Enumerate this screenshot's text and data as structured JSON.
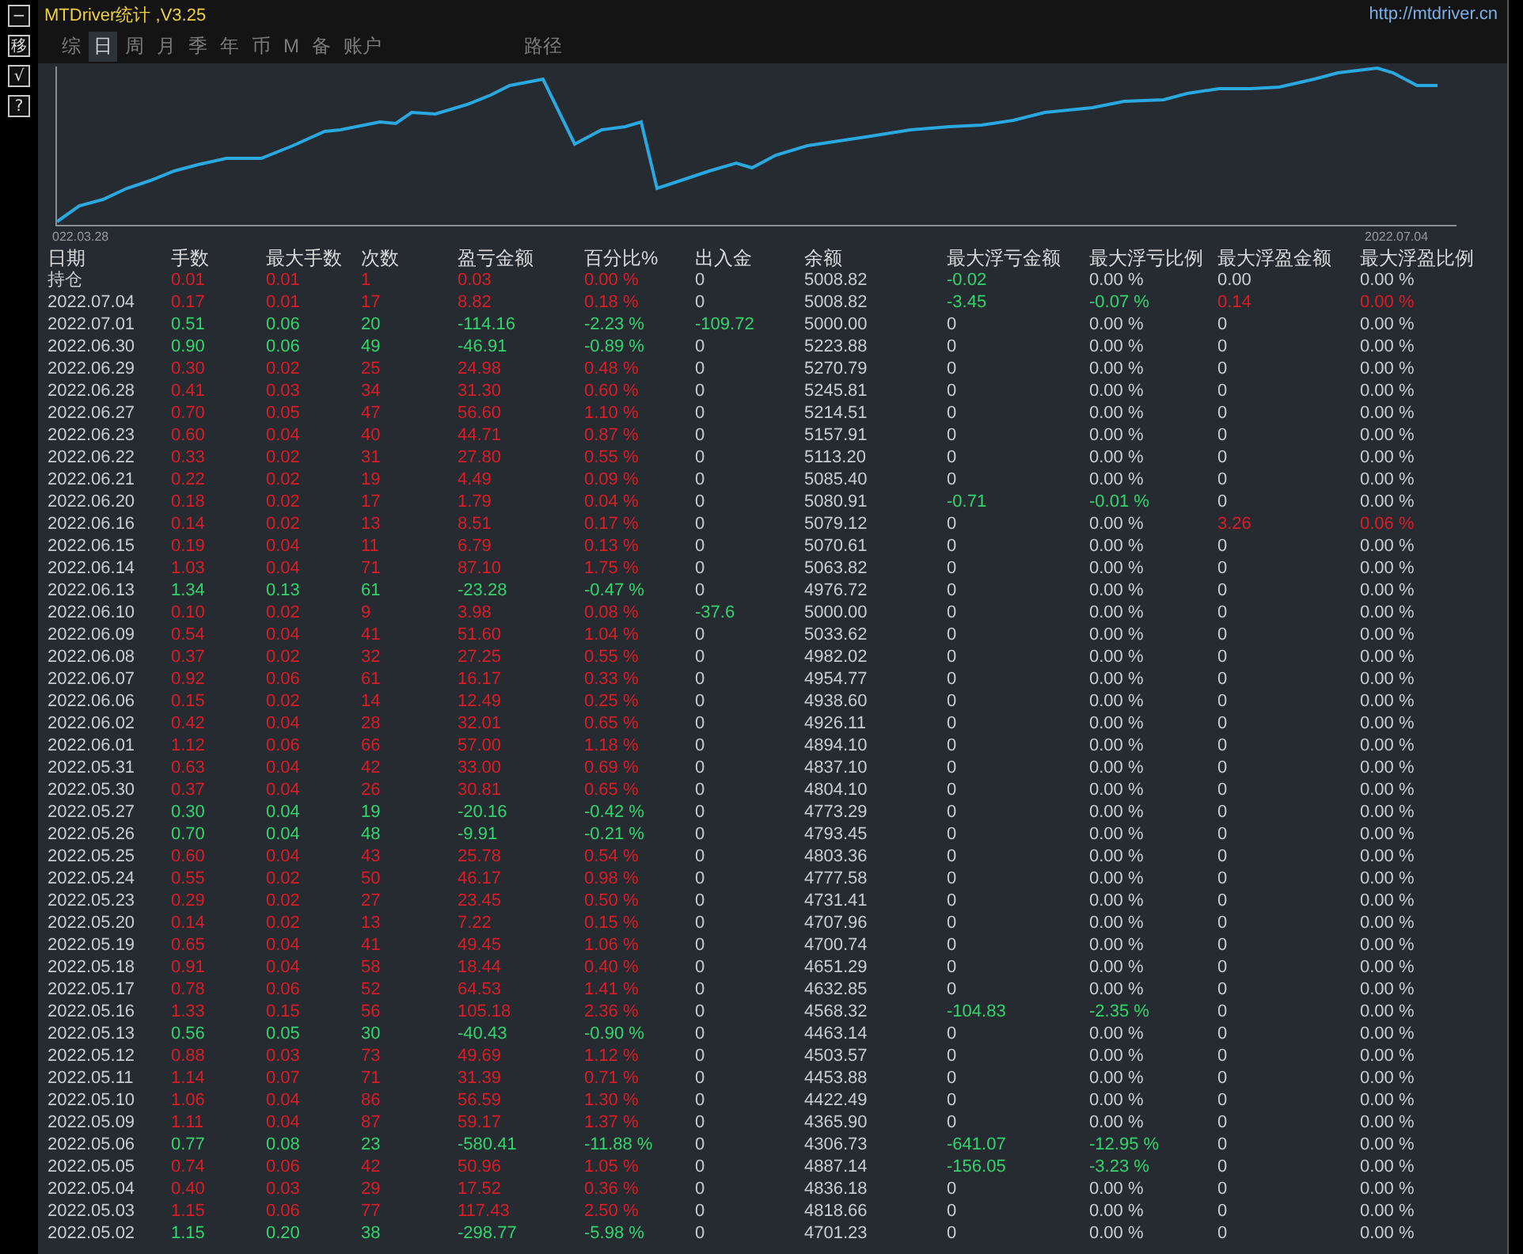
{
  "side_buttons": [
    "−",
    "移",
    "√",
    "?"
  ],
  "window": {
    "title": "MTDriver统计 ,V3.25",
    "link": "http://mtdriver.cn"
  },
  "tabs": [
    {
      "label": "综",
      "selected": false
    },
    {
      "label": "日",
      "selected": true
    },
    {
      "label": "周",
      "selected": false
    },
    {
      "label": "月",
      "selected": false
    },
    {
      "label": "季",
      "selected": false
    },
    {
      "label": "年",
      "selected": false
    },
    {
      "label": "币",
      "selected": false
    },
    {
      "label": "M",
      "selected": false
    },
    {
      "label": "备",
      "selected": false
    },
    {
      "label": "账户",
      "selected": false
    }
  ],
  "path_label": "路径",
  "equity_chart": {
    "start_label": "022.03.28",
    "end_label": "2022.07.04"
  },
  "table": {
    "columns": [
      "日期",
      "手数",
      "最大手数",
      "次数",
      "盈亏金额",
      "百分比%",
      "出入金",
      "余额",
      "最大浮亏金额",
      "最大浮亏比例",
      "最大浮盈金额",
      "最大浮盈比例"
    ],
    "rows": [
      {
        "cells": [
          "持仓",
          "0.01",
          "0.01",
          "1",
          "0.03",
          "0.00 %",
          "0",
          "5008.82",
          "-0.02",
          "0.00 %",
          "0.00",
          "0.00 %"
        ],
        "kind": "gain",
        "flow_highlighted": false,
        "float_loss_highlighted": true,
        "float_loss_pct_highlighted": false,
        "float_gain_highlighted": false
      },
      {
        "cells": [
          "2022.07.04",
          "0.17",
          "0.01",
          "17",
          "8.82",
          "0.18 %",
          "0",
          "5008.82",
          "-3.45",
          "-0.07 %",
          "0.14",
          "0.00 %"
        ],
        "kind": "gain",
        "flow_highlighted": false,
        "float_loss_highlighted": true,
        "float_loss_pct_highlighted": true,
        "float_gain_highlighted": true
      },
      {
        "cells": [
          "2022.07.01",
          "0.51",
          "0.06",
          "20",
          "-114.16",
          "-2.23 %",
          "-109.72",
          "5000.00",
          "0",
          "0.00 %",
          "0",
          "0.00 %"
        ],
        "kind": "loss",
        "flow_highlighted": true,
        "float_loss_highlighted": false,
        "float_loss_pct_highlighted": false,
        "float_gain_highlighted": false
      },
      {
        "cells": [
          "2022.06.30",
          "0.90",
          "0.06",
          "49",
          "-46.91",
          "-0.89 %",
          "0",
          "5223.88",
          "0",
          "0.00 %",
          "0",
          "0.00 %"
        ],
        "kind": "loss",
        "flow_highlighted": false,
        "float_loss_highlighted": false,
        "float_loss_pct_highlighted": false,
        "float_gain_highlighted": false
      },
      {
        "cells": [
          "2022.06.29",
          "0.30",
          "0.02",
          "25",
          "24.98",
          "0.48 %",
          "0",
          "5270.79",
          "0",
          "0.00 %",
          "0",
          "0.00 %"
        ],
        "kind": "gain",
        "flow_highlighted": false,
        "float_loss_highlighted": false,
        "float_loss_pct_highlighted": false,
        "float_gain_highlighted": false
      },
      {
        "cells": [
          "2022.06.28",
          "0.41",
          "0.03",
          "34",
          "31.30",
          "0.60 %",
          "0",
          "5245.81",
          "0",
          "0.00 %",
          "0",
          "0.00 %"
        ],
        "kind": "gain",
        "flow_highlighted": false,
        "float_loss_highlighted": false,
        "float_loss_pct_highlighted": false,
        "float_gain_highlighted": false
      },
      {
        "cells": [
          "2022.06.27",
          "0.70",
          "0.05",
          "47",
          "56.60",
          "1.10 %",
          "0",
          "5214.51",
          "0",
          "0.00 %",
          "0",
          "0.00 %"
        ],
        "kind": "gain",
        "flow_highlighted": false,
        "float_loss_highlighted": false,
        "float_loss_pct_highlighted": false,
        "float_gain_highlighted": false
      },
      {
        "cells": [
          "2022.06.23",
          "0.60",
          "0.04",
          "40",
          "44.71",
          "0.87 %",
          "0",
          "5157.91",
          "0",
          "0.00 %",
          "0",
          "0.00 %"
        ],
        "kind": "gain",
        "flow_highlighted": false,
        "float_loss_highlighted": false,
        "float_loss_pct_highlighted": false,
        "float_gain_highlighted": false
      },
      {
        "cells": [
          "2022.06.22",
          "0.33",
          "0.02",
          "31",
          "27.80",
          "0.55 %",
          "0",
          "5113.20",
          "0",
          "0.00 %",
          "0",
          "0.00 %"
        ],
        "kind": "gain",
        "flow_highlighted": false,
        "float_loss_highlighted": false,
        "float_loss_pct_highlighted": false,
        "float_gain_highlighted": false
      },
      {
        "cells": [
          "2022.06.21",
          "0.22",
          "0.02",
          "19",
          "4.49",
          "0.09 %",
          "0",
          "5085.40",
          "0",
          "0.00 %",
          "0",
          "0.00 %"
        ],
        "kind": "gain",
        "flow_highlighted": false,
        "float_loss_highlighted": false,
        "float_loss_pct_highlighted": false,
        "float_gain_highlighted": false
      },
      {
        "cells": [
          "2022.06.20",
          "0.18",
          "0.02",
          "17",
          "1.79",
          "0.04 %",
          "0",
          "5080.91",
          "-0.71",
          "-0.01 %",
          "0",
          "0.00 %"
        ],
        "kind": "gain",
        "flow_highlighted": false,
        "float_loss_highlighted": true,
        "float_loss_pct_highlighted": true,
        "float_gain_highlighted": false
      },
      {
        "cells": [
          "2022.06.16",
          "0.14",
          "0.02",
          "13",
          "8.51",
          "0.17 %",
          "0",
          "5079.12",
          "0",
          "0.00 %",
          "3.26",
          "0.06 %"
        ],
        "kind": "gain",
        "flow_highlighted": false,
        "float_loss_highlighted": false,
        "float_loss_pct_highlighted": false,
        "float_gain_highlighted": true
      },
      {
        "cells": [
          "2022.06.15",
          "0.19",
          "0.04",
          "11",
          "6.79",
          "0.13 %",
          "0",
          "5070.61",
          "0",
          "0.00 %",
          "0",
          "0.00 %"
        ],
        "kind": "gain",
        "flow_highlighted": false,
        "float_loss_highlighted": false,
        "float_loss_pct_highlighted": false,
        "float_gain_highlighted": false
      },
      {
        "cells": [
          "2022.06.14",
          "1.03",
          "0.04",
          "71",
          "87.10",
          "1.75 %",
          "0",
          "5063.82",
          "0",
          "0.00 %",
          "0",
          "0.00 %"
        ],
        "kind": "gain",
        "flow_highlighted": false,
        "float_loss_highlighted": false,
        "float_loss_pct_highlighted": false,
        "float_gain_highlighted": false
      },
      {
        "cells": [
          "2022.06.13",
          "1.34",
          "0.13",
          "61",
          "-23.28",
          "-0.47 %",
          "0",
          "4976.72",
          "0",
          "0.00 %",
          "0",
          "0.00 %"
        ],
        "kind": "loss",
        "flow_highlighted": false,
        "float_loss_highlighted": false,
        "float_loss_pct_highlighted": false,
        "float_gain_highlighted": false
      },
      {
        "cells": [
          "2022.06.10",
          "0.10",
          "0.02",
          "9",
          "3.98",
          "0.08 %",
          "-37.6",
          "5000.00",
          "0",
          "0.00 %",
          "0",
          "0.00 %"
        ],
        "kind": "gain",
        "flow_highlighted": true,
        "float_loss_highlighted": false,
        "float_loss_pct_highlighted": false,
        "float_gain_highlighted": false
      },
      {
        "cells": [
          "2022.06.09",
          "0.54",
          "0.04",
          "41",
          "51.60",
          "1.04 %",
          "0",
          "5033.62",
          "0",
          "0.00 %",
          "0",
          "0.00 %"
        ],
        "kind": "gain",
        "flow_highlighted": false,
        "float_loss_highlighted": false,
        "float_loss_pct_highlighted": false,
        "float_gain_highlighted": false
      },
      {
        "cells": [
          "2022.06.08",
          "0.37",
          "0.02",
          "32",
          "27.25",
          "0.55 %",
          "0",
          "4982.02",
          "0",
          "0.00 %",
          "0",
          "0.00 %"
        ],
        "kind": "gain",
        "flow_highlighted": false,
        "float_loss_highlighted": false,
        "float_loss_pct_highlighted": false,
        "float_gain_highlighted": false
      },
      {
        "cells": [
          "2022.06.07",
          "0.92",
          "0.06",
          "61",
          "16.17",
          "0.33 %",
          "0",
          "4954.77",
          "0",
          "0.00 %",
          "0",
          "0.00 %"
        ],
        "kind": "gain",
        "flow_highlighted": false,
        "float_loss_highlighted": false,
        "float_loss_pct_highlighted": false,
        "float_gain_highlighted": false
      },
      {
        "cells": [
          "2022.06.06",
          "0.15",
          "0.02",
          "14",
          "12.49",
          "0.25 %",
          "0",
          "4938.60",
          "0",
          "0.00 %",
          "0",
          "0.00 %"
        ],
        "kind": "gain",
        "flow_highlighted": false,
        "float_loss_highlighted": false,
        "float_loss_pct_highlighted": false,
        "float_gain_highlighted": false
      },
      {
        "cells": [
          "2022.06.02",
          "0.42",
          "0.04",
          "28",
          "32.01",
          "0.65 %",
          "0",
          "4926.11",
          "0",
          "0.00 %",
          "0",
          "0.00 %"
        ],
        "kind": "gain",
        "flow_highlighted": false,
        "float_loss_highlighted": false,
        "float_loss_pct_highlighted": false,
        "float_gain_highlighted": false
      },
      {
        "cells": [
          "2022.06.01",
          "1.12",
          "0.06",
          "66",
          "57.00",
          "1.18 %",
          "0",
          "4894.10",
          "0",
          "0.00 %",
          "0",
          "0.00 %"
        ],
        "kind": "gain",
        "flow_highlighted": false,
        "float_loss_highlighted": false,
        "float_loss_pct_highlighted": false,
        "float_gain_highlighted": false
      },
      {
        "cells": [
          "2022.05.31",
          "0.63",
          "0.04",
          "42",
          "33.00",
          "0.69 %",
          "0",
          "4837.10",
          "0",
          "0.00 %",
          "0",
          "0.00 %"
        ],
        "kind": "gain",
        "flow_highlighted": false,
        "float_loss_highlighted": false,
        "float_loss_pct_highlighted": false,
        "float_gain_highlighted": false
      },
      {
        "cells": [
          "2022.05.30",
          "0.37",
          "0.04",
          "26",
          "30.81",
          "0.65 %",
          "0",
          "4804.10",
          "0",
          "0.00 %",
          "0",
          "0.00 %"
        ],
        "kind": "gain",
        "flow_highlighted": false,
        "float_loss_highlighted": false,
        "float_loss_pct_highlighted": false,
        "float_gain_highlighted": false
      },
      {
        "cells": [
          "2022.05.27",
          "0.30",
          "0.04",
          "19",
          "-20.16",
          "-0.42 %",
          "0",
          "4773.29",
          "0",
          "0.00 %",
          "0",
          "0.00 %"
        ],
        "kind": "loss",
        "flow_highlighted": false,
        "float_loss_highlighted": false,
        "float_loss_pct_highlighted": false,
        "float_gain_highlighted": false
      },
      {
        "cells": [
          "2022.05.26",
          "0.70",
          "0.04",
          "48",
          "-9.91",
          "-0.21 %",
          "0",
          "4793.45",
          "0",
          "0.00 %",
          "0",
          "0.00 %"
        ],
        "kind": "loss",
        "flow_highlighted": false,
        "float_loss_highlighted": false,
        "float_loss_pct_highlighted": false,
        "float_gain_highlighted": false
      },
      {
        "cells": [
          "2022.05.25",
          "0.60",
          "0.04",
          "43",
          "25.78",
          "0.54 %",
          "0",
          "4803.36",
          "0",
          "0.00 %",
          "0",
          "0.00 %"
        ],
        "kind": "gain",
        "flow_highlighted": false,
        "float_loss_highlighted": false,
        "float_loss_pct_highlighted": false,
        "float_gain_highlighted": false
      },
      {
        "cells": [
          "2022.05.24",
          "0.55",
          "0.02",
          "50",
          "46.17",
          "0.98 %",
          "0",
          "4777.58",
          "0",
          "0.00 %",
          "0",
          "0.00 %"
        ],
        "kind": "gain",
        "flow_highlighted": false,
        "float_loss_highlighted": false,
        "float_loss_pct_highlighted": false,
        "float_gain_highlighted": false
      },
      {
        "cells": [
          "2022.05.23",
          "0.29",
          "0.02",
          "27",
          "23.45",
          "0.50 %",
          "0",
          "4731.41",
          "0",
          "0.00 %",
          "0",
          "0.00 %"
        ],
        "kind": "gain",
        "flow_highlighted": false,
        "float_loss_highlighted": false,
        "float_loss_pct_highlighted": false,
        "float_gain_highlighted": false
      },
      {
        "cells": [
          "2022.05.20",
          "0.14",
          "0.02",
          "13",
          "7.22",
          "0.15 %",
          "0",
          "4707.96",
          "0",
          "0.00 %",
          "0",
          "0.00 %"
        ],
        "kind": "gain",
        "flow_highlighted": false,
        "float_loss_highlighted": false,
        "float_loss_pct_highlighted": false,
        "float_gain_highlighted": false
      },
      {
        "cells": [
          "2022.05.19",
          "0.65",
          "0.04",
          "41",
          "49.45",
          "1.06 %",
          "0",
          "4700.74",
          "0",
          "0.00 %",
          "0",
          "0.00 %"
        ],
        "kind": "gain",
        "flow_highlighted": false,
        "float_loss_highlighted": false,
        "float_loss_pct_highlighted": false,
        "float_gain_highlighted": false
      },
      {
        "cells": [
          "2022.05.18",
          "0.91",
          "0.04",
          "58",
          "18.44",
          "0.40 %",
          "0",
          "4651.29",
          "0",
          "0.00 %",
          "0",
          "0.00 %"
        ],
        "kind": "gain",
        "flow_highlighted": false,
        "float_loss_highlighted": false,
        "float_loss_pct_highlighted": false,
        "float_gain_highlighted": false
      },
      {
        "cells": [
          "2022.05.17",
          "0.78",
          "0.06",
          "52",
          "64.53",
          "1.41 %",
          "0",
          "4632.85",
          "0",
          "0.00 %",
          "0",
          "0.00 %"
        ],
        "kind": "gain",
        "flow_highlighted": false,
        "float_loss_highlighted": false,
        "float_loss_pct_highlighted": false,
        "float_gain_highlighted": false
      },
      {
        "cells": [
          "2022.05.16",
          "1.33",
          "0.15",
          "56",
          "105.18",
          "2.36 %",
          "0",
          "4568.32",
          "-104.83",
          "-2.35 %",
          "0",
          "0.00 %"
        ],
        "kind": "gain",
        "flow_highlighted": false,
        "float_loss_highlighted": true,
        "float_loss_pct_highlighted": true,
        "float_gain_highlighted": false
      },
      {
        "cells": [
          "2022.05.13",
          "0.56",
          "0.05",
          "30",
          "-40.43",
          "-0.90 %",
          "0",
          "4463.14",
          "0",
          "0.00 %",
          "0",
          "0.00 %"
        ],
        "kind": "loss",
        "flow_highlighted": false,
        "float_loss_highlighted": false,
        "float_loss_pct_highlighted": false,
        "float_gain_highlighted": false
      },
      {
        "cells": [
          "2022.05.12",
          "0.88",
          "0.03",
          "73",
          "49.69",
          "1.12 %",
          "0",
          "4503.57",
          "0",
          "0.00 %",
          "0",
          "0.00 %"
        ],
        "kind": "gain",
        "flow_highlighted": false,
        "float_loss_highlighted": false,
        "float_loss_pct_highlighted": false,
        "float_gain_highlighted": false
      },
      {
        "cells": [
          "2022.05.11",
          "1.14",
          "0.07",
          "71",
          "31.39",
          "0.71 %",
          "0",
          "4453.88",
          "0",
          "0.00 %",
          "0",
          "0.00 %"
        ],
        "kind": "gain",
        "flow_highlighted": false,
        "float_loss_highlighted": false,
        "float_loss_pct_highlighted": false,
        "float_gain_highlighted": false
      },
      {
        "cells": [
          "2022.05.10",
          "1.06",
          "0.04",
          "86",
          "56.59",
          "1.30 %",
          "0",
          "4422.49",
          "0",
          "0.00 %",
          "0",
          "0.00 %"
        ],
        "kind": "gain",
        "flow_highlighted": false,
        "float_loss_highlighted": false,
        "float_loss_pct_highlighted": false,
        "float_gain_highlighted": false
      },
      {
        "cells": [
          "2022.05.09",
          "1.11",
          "0.04",
          "87",
          "59.17",
          "1.37 %",
          "0",
          "4365.90",
          "0",
          "0.00 %",
          "0",
          "0.00 %"
        ],
        "kind": "gain",
        "flow_highlighted": false,
        "float_loss_highlighted": false,
        "float_loss_pct_highlighted": false,
        "float_gain_highlighted": false
      },
      {
        "cells": [
          "2022.05.06",
          "0.77",
          "0.08",
          "23",
          "-580.41",
          "-11.88 %",
          "0",
          "4306.73",
          "-641.07",
          "-12.95 %",
          "0",
          "0.00 %"
        ],
        "kind": "loss",
        "flow_highlighted": false,
        "float_loss_highlighted": true,
        "float_loss_pct_highlighted": true,
        "float_gain_highlighted": false
      },
      {
        "cells": [
          "2022.05.05",
          "0.74",
          "0.06",
          "42",
          "50.96",
          "1.05 %",
          "0",
          "4887.14",
          "-156.05",
          "-3.23 %",
          "0",
          "0.00 %"
        ],
        "kind": "gain",
        "flow_highlighted": false,
        "float_loss_highlighted": true,
        "float_loss_pct_highlighted": true,
        "float_gain_highlighted": false
      },
      {
        "cells": [
          "2022.05.04",
          "0.40",
          "0.03",
          "29",
          "17.52",
          "0.36 %",
          "0",
          "4836.18",
          "0",
          "0.00 %",
          "0",
          "0.00 %"
        ],
        "kind": "gain",
        "flow_highlighted": false,
        "float_loss_highlighted": false,
        "float_loss_pct_highlighted": false,
        "float_gain_highlighted": false
      },
      {
        "cells": [
          "2022.05.03",
          "1.15",
          "0.06",
          "77",
          "117.43",
          "2.50 %",
          "0",
          "4818.66",
          "0",
          "0.00 %",
          "0",
          "0.00 %"
        ],
        "kind": "gain",
        "flow_highlighted": false,
        "float_loss_highlighted": false,
        "float_loss_pct_highlighted": false,
        "float_gain_highlighted": false
      },
      {
        "cells": [
          "2022.05.02",
          "1.15",
          "0.20",
          "38",
          "-298.77",
          "-5.98 %",
          "0",
          "4701.23",
          "0",
          "0.00 %",
          "0",
          "0.00 %"
        ],
        "kind": "loss",
        "flow_highlighted": false,
        "float_loss_highlighted": false,
        "float_loss_pct_highlighted": false,
        "float_gain_highlighted": false
      }
    ]
  }
}
